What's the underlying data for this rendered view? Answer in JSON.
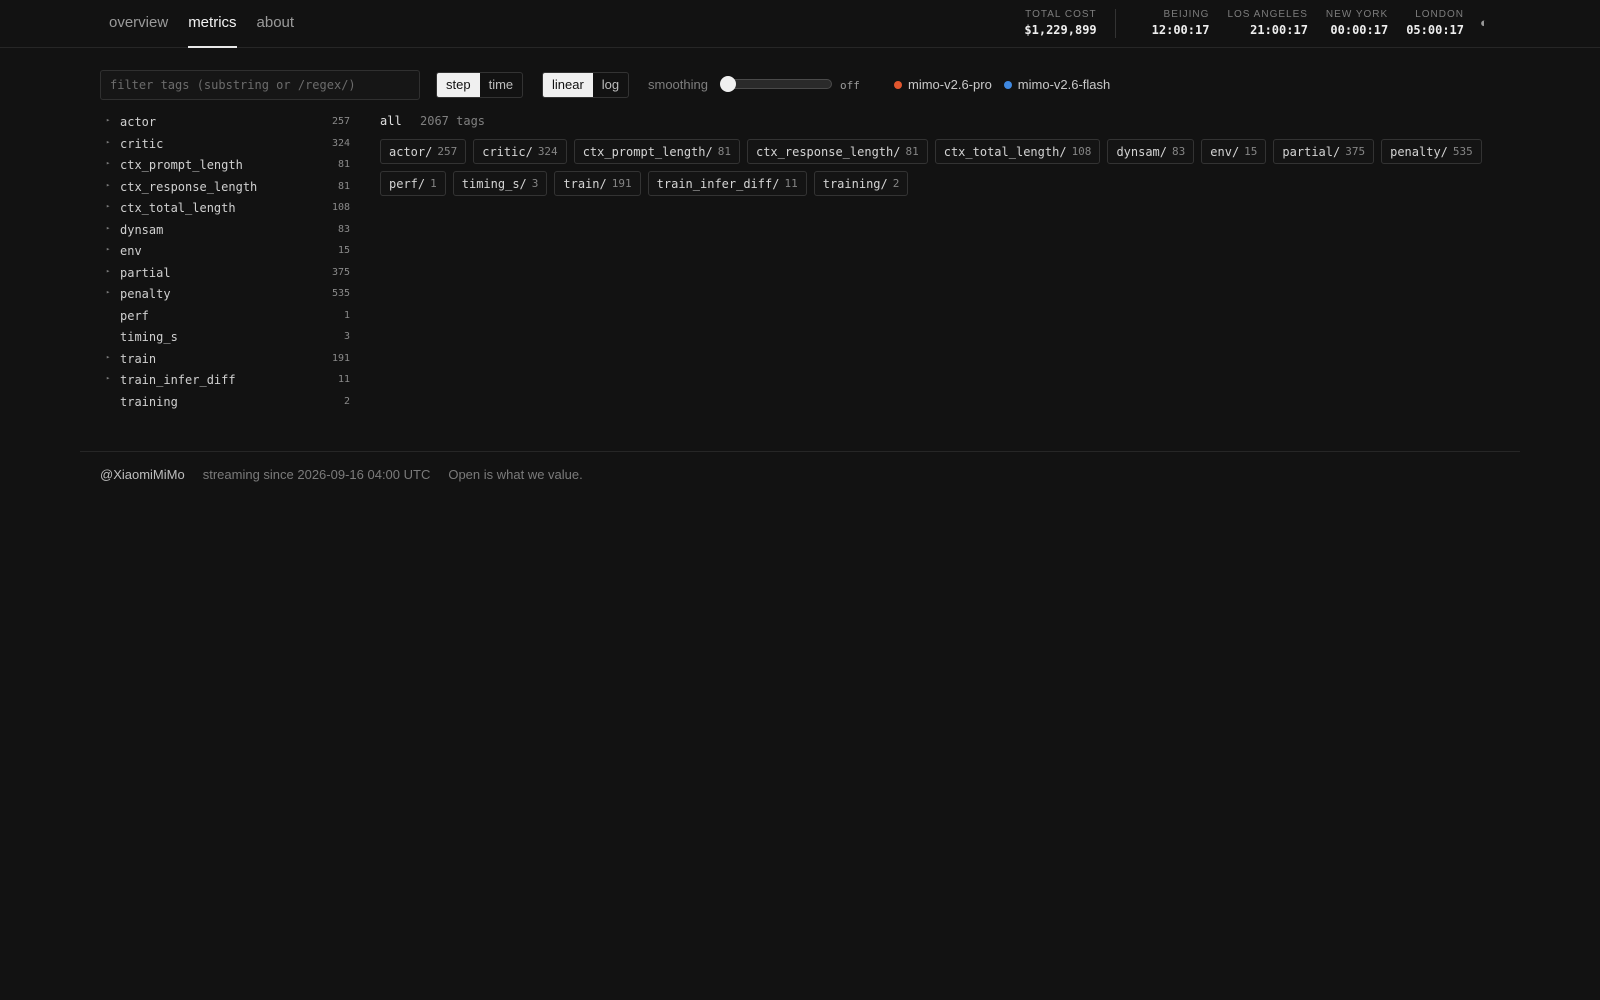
{
  "nav": {
    "items": [
      {
        "label": "overview",
        "active": false
      },
      {
        "label": "metrics",
        "active": true
      },
      {
        "label": "about",
        "active": false
      }
    ]
  },
  "stats": {
    "cost": {
      "label": "TOTAL COST",
      "value": "$1,229,899"
    },
    "cities": [
      {
        "label": "BEIJING",
        "value": "12:00:17"
      },
      {
        "label": "LOS ANGELES",
        "value": "21:00:17"
      },
      {
        "label": "NEW YORK",
        "value": "00:00:17"
      },
      {
        "label": "LONDON",
        "value": "05:00:17"
      }
    ],
    "theme_icon": "◐"
  },
  "controls": {
    "filter_placeholder": "filter tags (substring or /regex/)",
    "axis_options": [
      "step",
      "time"
    ],
    "axis_selected": "step",
    "scale_options": [
      "linear",
      "log"
    ],
    "scale_selected": "linear",
    "smoothing_label": "smoothing",
    "smoothing_value_text": "off",
    "smoothing_level": 0
  },
  "legend": [
    {
      "label": "mimo-v2.6-pro",
      "color": "#e0562e"
    },
    {
      "label": "mimo-v2.6-flash",
      "color": "#3f88e0"
    }
  ],
  "tree": [
    {
      "name": "actor",
      "count": "257",
      "expandable": true
    },
    {
      "name": "critic",
      "count": "324",
      "expandable": true
    },
    {
      "name": "ctx_prompt_length",
      "count": "81",
      "expandable": true
    },
    {
      "name": "ctx_response_length",
      "count": "81",
      "expandable": true
    },
    {
      "name": "ctx_total_length",
      "count": "108",
      "expandable": true
    },
    {
      "name": "dynsam",
      "count": "83",
      "expandable": true
    },
    {
      "name": "env",
      "count": "15",
      "expandable": true
    },
    {
      "name": "partial",
      "count": "375",
      "expandable": true
    },
    {
      "name": "penalty",
      "count": "535",
      "expandable": true
    },
    {
      "name": "perf",
      "count": "1",
      "expandable": false
    },
    {
      "name": "timing_s",
      "count": "3",
      "expandable": false
    },
    {
      "name": "train",
      "count": "191",
      "expandable": true
    },
    {
      "name": "train_infer_diff",
      "count": "11",
      "expandable": true
    },
    {
      "name": "training",
      "count": "2",
      "expandable": false
    }
  ],
  "summary": {
    "all_label": "all",
    "tag_count": "2067 tags"
  },
  "chips": [
    {
      "name": "actor/",
      "count": "257"
    },
    {
      "name": "critic/",
      "count": "324"
    },
    {
      "name": "ctx_prompt_length/",
      "count": "81"
    },
    {
      "name": "ctx_response_length/",
      "count": "81"
    },
    {
      "name": "ctx_total_length/",
      "count": "108"
    },
    {
      "name": "dynsam/",
      "count": "83"
    },
    {
      "name": "env/",
      "count": "15"
    },
    {
      "name": "partial/",
      "count": "375"
    },
    {
      "name": "penalty/",
      "count": "535"
    },
    {
      "name": "perf/",
      "count": "1"
    },
    {
      "name": "timing_s/",
      "count": "3"
    },
    {
      "name": "train/",
      "count": "191"
    },
    {
      "name": "train_infer_diff/",
      "count": "11"
    },
    {
      "name": "training/",
      "count": "2"
    }
  ],
  "footer": {
    "handle": "@XiaomiMiMo",
    "streaming": "streaming since 2026-09-16 04:00 UTC",
    "motto": "Open is what we value."
  }
}
